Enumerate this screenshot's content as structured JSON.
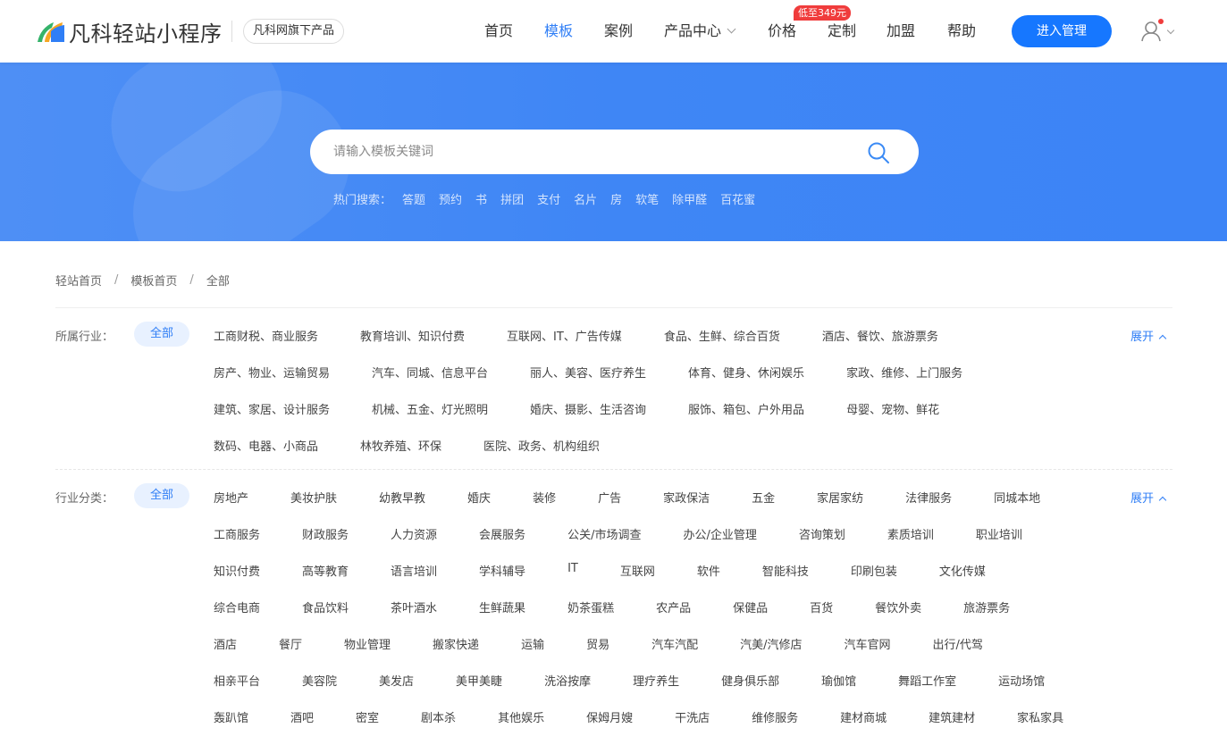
{
  "header": {
    "logo_text": "凡科轻站小程序",
    "sub_badge": "凡科网旗下产品",
    "nav": [
      {
        "label": "首页"
      },
      {
        "label": "模板"
      },
      {
        "label": "案例"
      },
      {
        "label": "产品中心"
      },
      {
        "label": "价格"
      },
      {
        "label": "定制"
      },
      {
        "label": "加盟"
      },
      {
        "label": "帮助"
      }
    ],
    "active_nav": "模板",
    "price_tag": "低至349元",
    "manage_button": "进入管理",
    "colors": {
      "accent": "#1677ff",
      "badge": "#f03c3c"
    }
  },
  "banner": {
    "search_placeholder": "请输入模板关键词",
    "hot_label": "热门搜索：",
    "hot_terms": [
      "答题",
      "预约",
      "书",
      "拼团",
      "支付",
      "名片",
      "房",
      "软笔",
      "除甲醛",
      "百花蜜"
    ]
  },
  "breadcrumb": [
    "轻站首页",
    "模板首页",
    "全部"
  ],
  "breadcrumb_sep": "/",
  "industry": {
    "label": "所属行业：",
    "all": "全部",
    "expand": "展开",
    "rows": [
      [
        "工商财税、商业服务",
        "教育培训、知识付费",
        "互联网、IT、广告传媒",
        "食品、生鲜、综合百货",
        "酒店、餐饮、旅游票务"
      ],
      [
        "房产、物业、运输贸易",
        "汽车、同城、信息平台",
        "丽人、美容、医疗养生",
        "体育、健身、休闲娱乐",
        "家政、维修、上门服务"
      ],
      [
        "建筑、家居、设计服务",
        "机械、五金、灯光照明",
        "婚庆、摄影、生活咨询",
        "服饰、箱包、户外用品",
        "母婴、宠物、鲜花"
      ],
      [
        "数码、电器、小商品",
        "林牧养殖、环保",
        "医院、政务、机构组织"
      ]
    ]
  },
  "category": {
    "label": "行业分类：",
    "all": "全部",
    "expand": "展开",
    "rows": [
      [
        "房地产",
        "美妆护肤",
        "幼教早教",
        "婚庆",
        "装修",
        "广告",
        "家政保洁",
        "五金",
        "家居家纺",
        "法律服务",
        "同城本地"
      ],
      [
        "工商服务",
        "财政服务",
        "人力资源",
        "会展服务",
        "公关/市场调查",
        "办公/企业管理",
        "咨询策划",
        "素质培训",
        "职业培训"
      ],
      [
        "知识付费",
        "高等教育",
        "语言培训",
        "学科辅导",
        "IT",
        "互联网",
        "软件",
        "智能科技",
        "印刷包装",
        "文化传媒"
      ],
      [
        "综合电商",
        "食品饮料",
        "茶叶酒水",
        "生鲜蔬果",
        "奶茶蛋糕",
        "农产品",
        "保健品",
        "百货",
        "餐饮外卖",
        "旅游票务"
      ],
      [
        "酒店",
        "餐厅",
        "物业管理",
        "搬家快递",
        "运输",
        "贸易",
        "汽车汽配",
        "汽美/汽修店",
        "汽车官网",
        "出行/代驾"
      ],
      [
        "相亲平台",
        "美容院",
        "美发店",
        "美甲美睫",
        "洗浴按摩",
        "理疗养生",
        "健身俱乐部",
        "瑜伽馆",
        "舞蹈工作室",
        "运动场馆"
      ],
      [
        "轰趴馆",
        "酒吧",
        "密室",
        "剧本杀",
        "其他娱乐",
        "保姆月嫂",
        "干洗店",
        "维修服务",
        "建材商城",
        "建筑建材",
        "家私家具"
      ]
    ]
  }
}
